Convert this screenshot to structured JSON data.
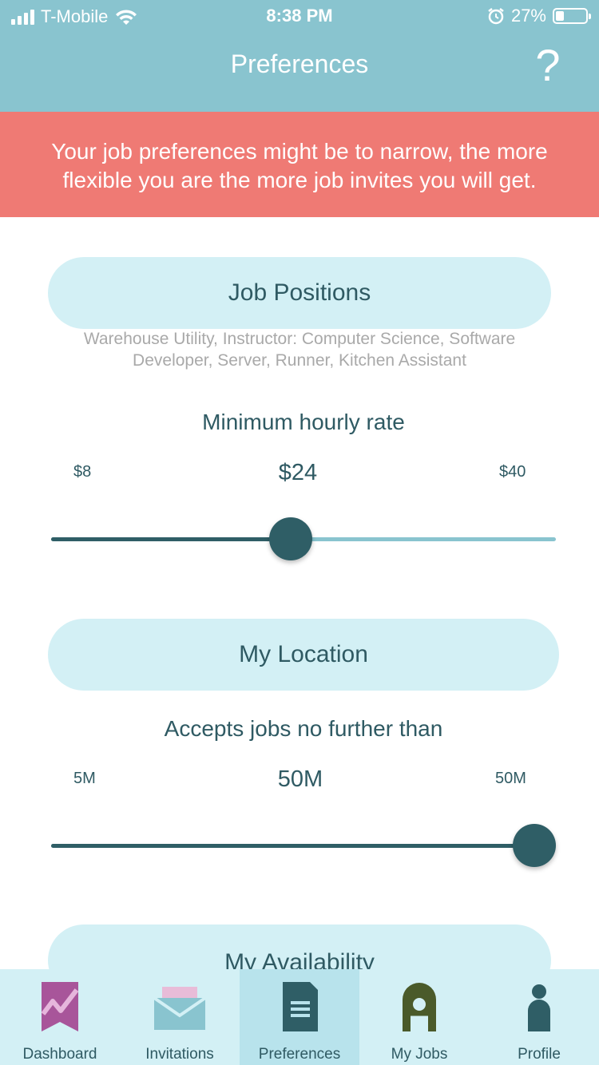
{
  "status_bar": {
    "carrier": "T-Mobile",
    "time": "8:38 PM",
    "battery": "27%",
    "battery_level": 0.27
  },
  "header": {
    "title": "Preferences",
    "help": "?"
  },
  "warning": {
    "text": "Your job preferences might be to narrow, the more flexible you are the more job invites you will get."
  },
  "job_positions": {
    "label": "Job Positions",
    "selected": "Warehouse Utility, Instructor: Computer Science, Software Developer, Server, Runner, Kitchen Assistant"
  },
  "hourly_rate": {
    "label": "Minimum hourly rate",
    "min_label": "$8",
    "max_label": "$40",
    "value_label": "$24",
    "min": 8,
    "max": 40,
    "value": 24
  },
  "location": {
    "label": "My Location",
    "distance_label": "Accepts jobs no further than",
    "min_label": "5M",
    "max_label": "50M",
    "value_label": "50M",
    "min": 5,
    "max": 50,
    "value": 50
  },
  "availability": {
    "label": "My Availability"
  },
  "tabs": [
    {
      "label": "Dashboard",
      "icon": "chart-ribbon-icon",
      "active": false
    },
    {
      "label": "Invitations",
      "icon": "envelope-icon",
      "active": false
    },
    {
      "label": "Preferences",
      "icon": "document-icon",
      "active": true
    },
    {
      "label": "My Jobs",
      "icon": "hardhat-icon",
      "active": false
    },
    {
      "label": "Profile",
      "icon": "person-icon",
      "active": false
    }
  ],
  "colors": {
    "header": "#89c4cf",
    "warning": "#ef7a74",
    "pill": "#d3f0f5",
    "accent": "#2f5e66",
    "dashboard_icon": "#a8559a",
    "myjobs_icon": "#4a5a2a"
  }
}
